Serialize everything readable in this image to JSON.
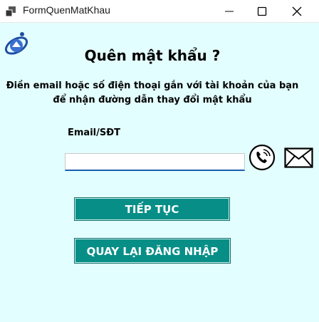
{
  "window": {
    "title": "FormQuenMatKhau"
  },
  "form": {
    "heading": "Quên mật khẩu ?",
    "description": "Điền email hoặc số điện thoại gắn với tài khoản của bạn để nhận đường dẫn thay đổi mật khẩu",
    "field_label": "Email/SĐT",
    "input_value": ""
  },
  "buttons": {
    "next_label": "TIẾP TỤC",
    "back_label": "QUAY LẠI ĐĂNG NHẬP"
  },
  "icons": {
    "phone": "phone-call-icon",
    "mail": "envelope-icon",
    "logo": "school-logo-icon"
  },
  "colors": {
    "background": "#e3fefe",
    "button": "#078f87",
    "input_underline": "#1a5fb4"
  }
}
